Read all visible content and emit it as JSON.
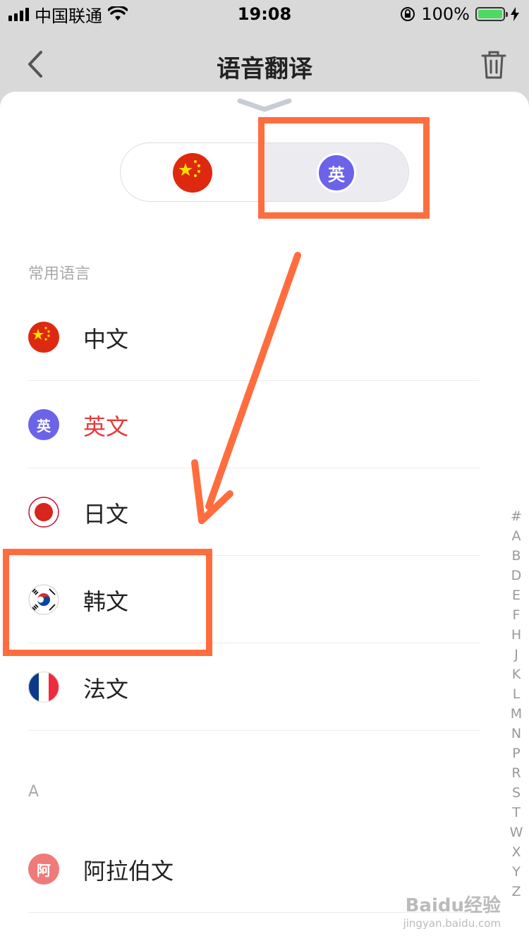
{
  "status_bar": {
    "carrier": "中国联通",
    "time": "19:08",
    "battery": "100%",
    "icons": [
      "signal-icon",
      "wifi-icon",
      "rotation-lock-icon",
      "battery-icon",
      "charging-icon"
    ]
  },
  "nav": {
    "title": "语音翻译",
    "back_icon": "chevron-left-icon",
    "delete_icon": "trash-icon"
  },
  "switcher": {
    "source_flag": "china-flag-icon",
    "target_badge": "英",
    "target_color": "#6b63e8"
  },
  "sections": {
    "common_label": "常用语言",
    "a_label": "A"
  },
  "languages": [
    {
      "name": "中文",
      "icon": "china-flag-icon"
    },
    {
      "name": "英文",
      "icon": "english-badge-icon",
      "badge": "英",
      "selected": true
    },
    {
      "name": "日文",
      "icon": "japan-flag-icon"
    },
    {
      "name": "韩文",
      "icon": "korea-flag-icon"
    },
    {
      "name": "法文",
      "icon": "france-flag-icon"
    },
    {
      "name": "阿拉伯文",
      "icon": "arabic-badge-icon",
      "badge": "阿"
    }
  ],
  "alpha_index": [
    "#",
    "A",
    "B",
    "D",
    "E",
    "F",
    "H",
    "J",
    "K",
    "L",
    "M",
    "N",
    "P",
    "R",
    "S",
    "T",
    "W",
    "X",
    "Y",
    "Z"
  ],
  "colors": {
    "selected_text": "#e53a3a",
    "annotation": "#ff6d3f",
    "english_badge": "#6b63e8",
    "arabic_badge": "#f07a7a"
  },
  "watermark": {
    "brand": "Baidu经验",
    "url": "jingyan.baidu.com"
  }
}
